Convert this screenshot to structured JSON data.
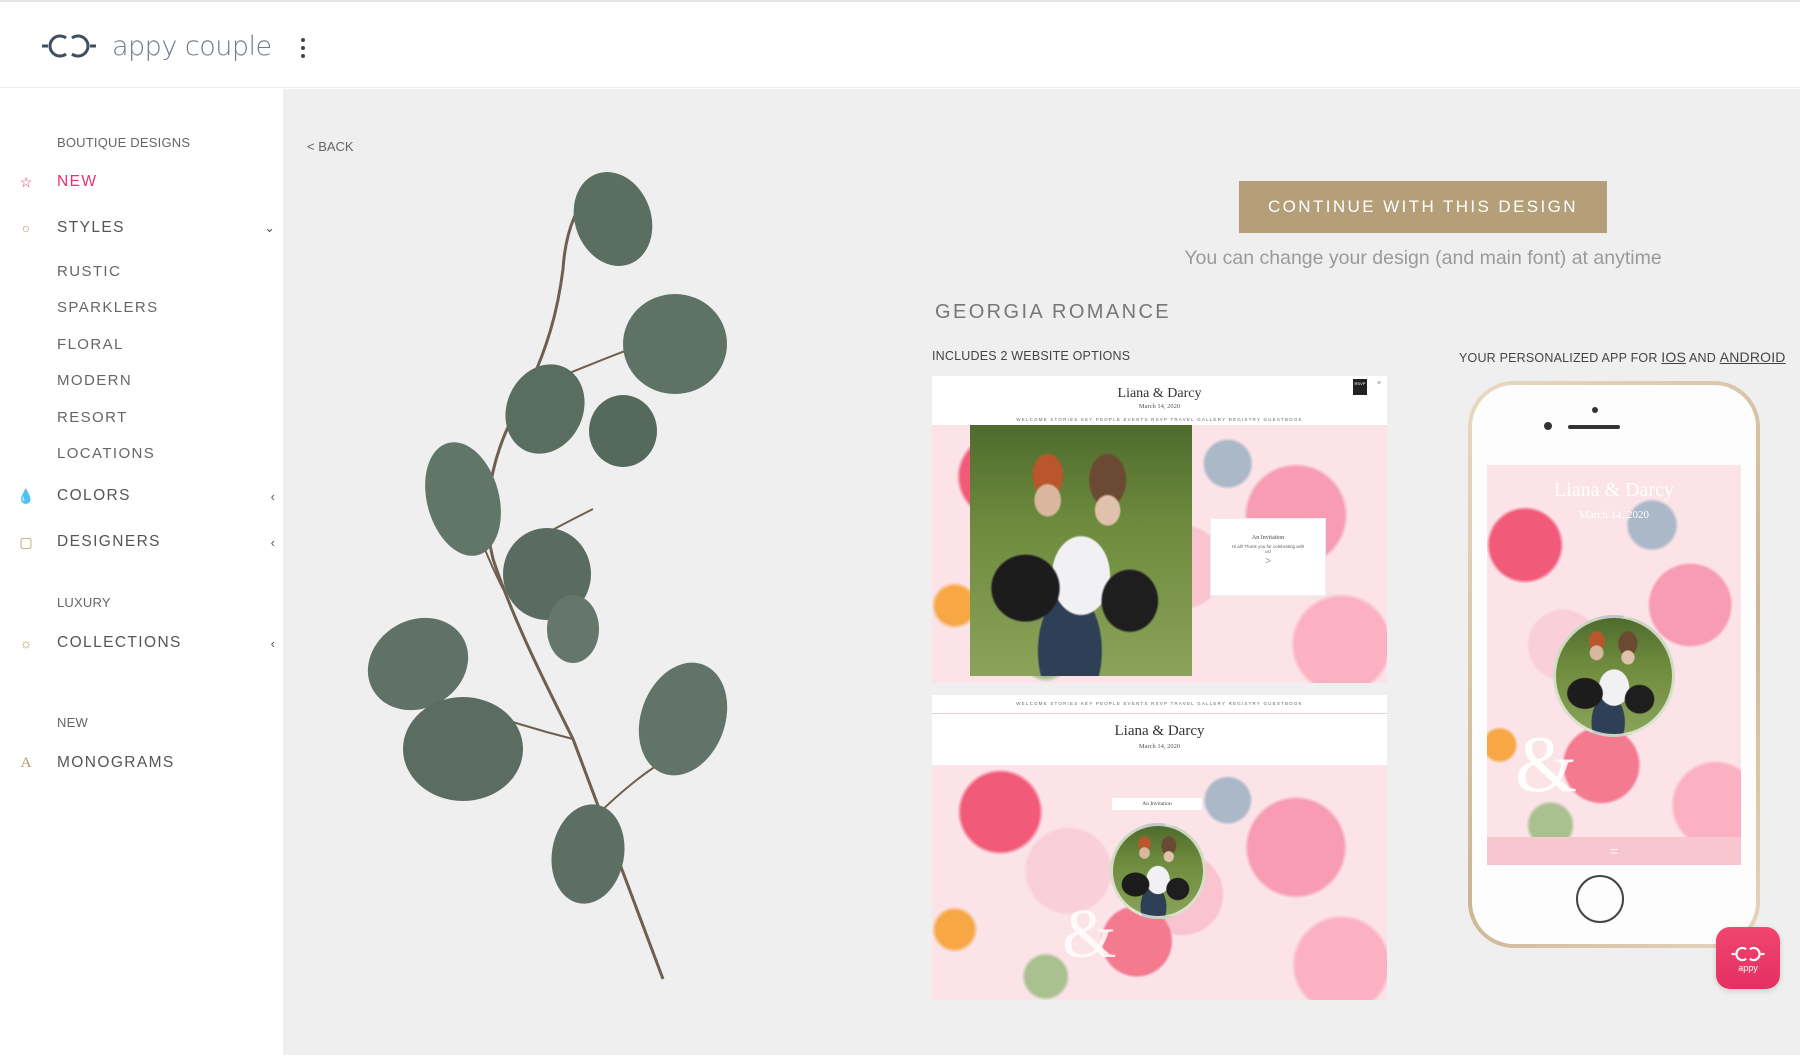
{
  "brand": {
    "name": "appy couple"
  },
  "sidebar": {
    "section_boutique": "BOUTIQUE DESIGNS",
    "new": "NEW",
    "styles": "STYLES",
    "styles_items": [
      "RUSTIC",
      "SPARKLERS",
      "FLORAL",
      "MODERN",
      "RESORT",
      "LOCATIONS"
    ],
    "colors": "COLORS",
    "designers": "DESIGNERS",
    "section_luxury": "LUXURY",
    "collections": "COLLECTIONS",
    "section_new": "NEW",
    "monograms": "MONOGRAMS",
    "monogram_glyph": "A",
    "accent_color": "#e6336e"
  },
  "main": {
    "back": "< BACK",
    "cta": "CONTINUE WITH THIS DESIGN",
    "cta_note": "You can change your design (and main font) at anytime",
    "design_name": "GEORGIA ROMANCE",
    "web_label": "INCLUDES 2 WEBSITE OPTIONS",
    "app_label_prefix": "YOUR PERSONALIZED APP FOR",
    "app_ios": "IOS",
    "app_and": "AND",
    "app_android": "ANDROID"
  },
  "preview": {
    "couple": "Liana & Darcy",
    "date": "March 14, 2020",
    "nav": "WELCOME   STORIES   KEY PEOPLE   EVENTS   RSVP   TRAVEL   GALLERY   REGISTRY   GUESTBOOK",
    "rsvp_tag": "RSVP",
    "invitation_title": "An Invitation",
    "invitation_text": "Hi all! Thank you for celebrating with us!",
    "invitation_chevron": ">",
    "ampersand": "&"
  },
  "phone": {
    "couple": "Liana & Darcy",
    "date": "March 14, 2020",
    "menu_glyph": "="
  },
  "badge": {
    "label": "appy"
  }
}
